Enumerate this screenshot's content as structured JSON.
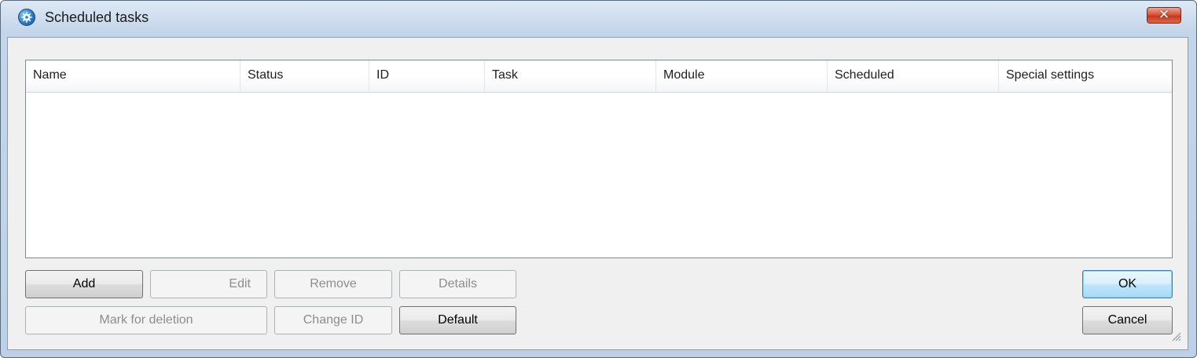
{
  "window": {
    "title": "Scheduled tasks",
    "close_glyph": "✕"
  },
  "list": {
    "columns": [
      "Name",
      "Status",
      "ID",
      "Task",
      "Module",
      "Scheduled",
      "Special settings"
    ],
    "rows": []
  },
  "buttons": {
    "add": "Add",
    "edit": "Edit",
    "remove": "Remove",
    "details": "Details",
    "mark_for_deletion": "Mark for deletion",
    "change_id": "Change ID",
    "default": "Default",
    "ok": "OK",
    "cancel": "Cancel"
  },
  "colors": {
    "title_bar": "#c3d5ea",
    "close_button": "#c5381f",
    "focus_border": "#3c7fb1"
  },
  "icons": {
    "app": "gear-icon",
    "close": "close-icon",
    "resize": "resize-grip-icon"
  }
}
